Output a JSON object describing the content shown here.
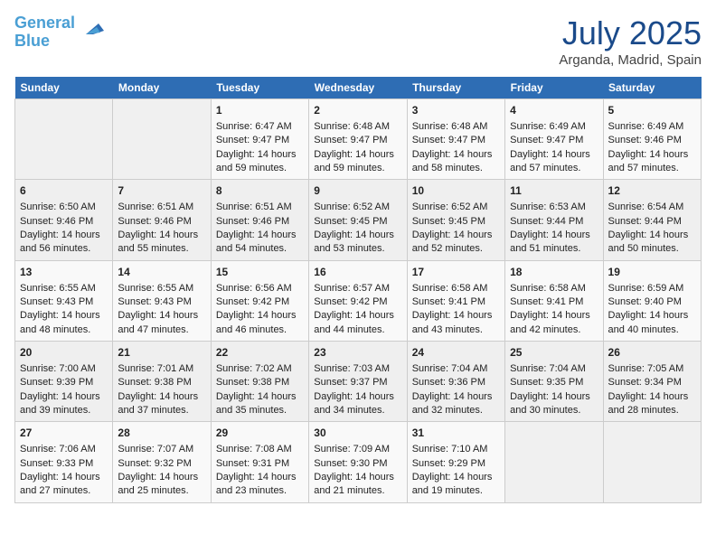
{
  "header": {
    "logo_line1": "General",
    "logo_line2": "Blue",
    "month_title": "July 2025",
    "location": "Arganda, Madrid, Spain"
  },
  "weekdays": [
    "Sunday",
    "Monday",
    "Tuesday",
    "Wednesday",
    "Thursday",
    "Friday",
    "Saturday"
  ],
  "weeks": [
    [
      {
        "day": "",
        "sunrise": "",
        "sunset": "",
        "daylight": ""
      },
      {
        "day": "",
        "sunrise": "",
        "sunset": "",
        "daylight": ""
      },
      {
        "day": "1",
        "sunrise": "Sunrise: 6:47 AM",
        "sunset": "Sunset: 9:47 PM",
        "daylight": "Daylight: 14 hours and 59 minutes."
      },
      {
        "day": "2",
        "sunrise": "Sunrise: 6:48 AM",
        "sunset": "Sunset: 9:47 PM",
        "daylight": "Daylight: 14 hours and 59 minutes."
      },
      {
        "day": "3",
        "sunrise": "Sunrise: 6:48 AM",
        "sunset": "Sunset: 9:47 PM",
        "daylight": "Daylight: 14 hours and 58 minutes."
      },
      {
        "day": "4",
        "sunrise": "Sunrise: 6:49 AM",
        "sunset": "Sunset: 9:47 PM",
        "daylight": "Daylight: 14 hours and 57 minutes."
      },
      {
        "day": "5",
        "sunrise": "Sunrise: 6:49 AM",
        "sunset": "Sunset: 9:46 PM",
        "daylight": "Daylight: 14 hours and 57 minutes."
      }
    ],
    [
      {
        "day": "6",
        "sunrise": "Sunrise: 6:50 AM",
        "sunset": "Sunset: 9:46 PM",
        "daylight": "Daylight: 14 hours and 56 minutes."
      },
      {
        "day": "7",
        "sunrise": "Sunrise: 6:51 AM",
        "sunset": "Sunset: 9:46 PM",
        "daylight": "Daylight: 14 hours and 55 minutes."
      },
      {
        "day": "8",
        "sunrise": "Sunrise: 6:51 AM",
        "sunset": "Sunset: 9:46 PM",
        "daylight": "Daylight: 14 hours and 54 minutes."
      },
      {
        "day": "9",
        "sunrise": "Sunrise: 6:52 AM",
        "sunset": "Sunset: 9:45 PM",
        "daylight": "Daylight: 14 hours and 53 minutes."
      },
      {
        "day": "10",
        "sunrise": "Sunrise: 6:52 AM",
        "sunset": "Sunset: 9:45 PM",
        "daylight": "Daylight: 14 hours and 52 minutes."
      },
      {
        "day": "11",
        "sunrise": "Sunrise: 6:53 AM",
        "sunset": "Sunset: 9:44 PM",
        "daylight": "Daylight: 14 hours and 51 minutes."
      },
      {
        "day": "12",
        "sunrise": "Sunrise: 6:54 AM",
        "sunset": "Sunset: 9:44 PM",
        "daylight": "Daylight: 14 hours and 50 minutes."
      }
    ],
    [
      {
        "day": "13",
        "sunrise": "Sunrise: 6:55 AM",
        "sunset": "Sunset: 9:43 PM",
        "daylight": "Daylight: 14 hours and 48 minutes."
      },
      {
        "day": "14",
        "sunrise": "Sunrise: 6:55 AM",
        "sunset": "Sunset: 9:43 PM",
        "daylight": "Daylight: 14 hours and 47 minutes."
      },
      {
        "day": "15",
        "sunrise": "Sunrise: 6:56 AM",
        "sunset": "Sunset: 9:42 PM",
        "daylight": "Daylight: 14 hours and 46 minutes."
      },
      {
        "day": "16",
        "sunrise": "Sunrise: 6:57 AM",
        "sunset": "Sunset: 9:42 PM",
        "daylight": "Daylight: 14 hours and 44 minutes."
      },
      {
        "day": "17",
        "sunrise": "Sunrise: 6:58 AM",
        "sunset": "Sunset: 9:41 PM",
        "daylight": "Daylight: 14 hours and 43 minutes."
      },
      {
        "day": "18",
        "sunrise": "Sunrise: 6:58 AM",
        "sunset": "Sunset: 9:41 PM",
        "daylight": "Daylight: 14 hours and 42 minutes."
      },
      {
        "day": "19",
        "sunrise": "Sunrise: 6:59 AM",
        "sunset": "Sunset: 9:40 PM",
        "daylight": "Daylight: 14 hours and 40 minutes."
      }
    ],
    [
      {
        "day": "20",
        "sunrise": "Sunrise: 7:00 AM",
        "sunset": "Sunset: 9:39 PM",
        "daylight": "Daylight: 14 hours and 39 minutes."
      },
      {
        "day": "21",
        "sunrise": "Sunrise: 7:01 AM",
        "sunset": "Sunset: 9:38 PM",
        "daylight": "Daylight: 14 hours and 37 minutes."
      },
      {
        "day": "22",
        "sunrise": "Sunrise: 7:02 AM",
        "sunset": "Sunset: 9:38 PM",
        "daylight": "Daylight: 14 hours and 35 minutes."
      },
      {
        "day": "23",
        "sunrise": "Sunrise: 7:03 AM",
        "sunset": "Sunset: 9:37 PM",
        "daylight": "Daylight: 14 hours and 34 minutes."
      },
      {
        "day": "24",
        "sunrise": "Sunrise: 7:04 AM",
        "sunset": "Sunset: 9:36 PM",
        "daylight": "Daylight: 14 hours and 32 minutes."
      },
      {
        "day": "25",
        "sunrise": "Sunrise: 7:04 AM",
        "sunset": "Sunset: 9:35 PM",
        "daylight": "Daylight: 14 hours and 30 minutes."
      },
      {
        "day": "26",
        "sunrise": "Sunrise: 7:05 AM",
        "sunset": "Sunset: 9:34 PM",
        "daylight": "Daylight: 14 hours and 28 minutes."
      }
    ],
    [
      {
        "day": "27",
        "sunrise": "Sunrise: 7:06 AM",
        "sunset": "Sunset: 9:33 PM",
        "daylight": "Daylight: 14 hours and 27 minutes."
      },
      {
        "day": "28",
        "sunrise": "Sunrise: 7:07 AM",
        "sunset": "Sunset: 9:32 PM",
        "daylight": "Daylight: 14 hours and 25 minutes."
      },
      {
        "day": "29",
        "sunrise": "Sunrise: 7:08 AM",
        "sunset": "Sunset: 9:31 PM",
        "daylight": "Daylight: 14 hours and 23 minutes."
      },
      {
        "day": "30",
        "sunrise": "Sunrise: 7:09 AM",
        "sunset": "Sunset: 9:30 PM",
        "daylight": "Daylight: 14 hours and 21 minutes."
      },
      {
        "day": "31",
        "sunrise": "Sunrise: 7:10 AM",
        "sunset": "Sunset: 9:29 PM",
        "daylight": "Daylight: 14 hours and 19 minutes."
      },
      {
        "day": "",
        "sunrise": "",
        "sunset": "",
        "daylight": ""
      },
      {
        "day": "",
        "sunrise": "",
        "sunset": "",
        "daylight": ""
      }
    ]
  ]
}
